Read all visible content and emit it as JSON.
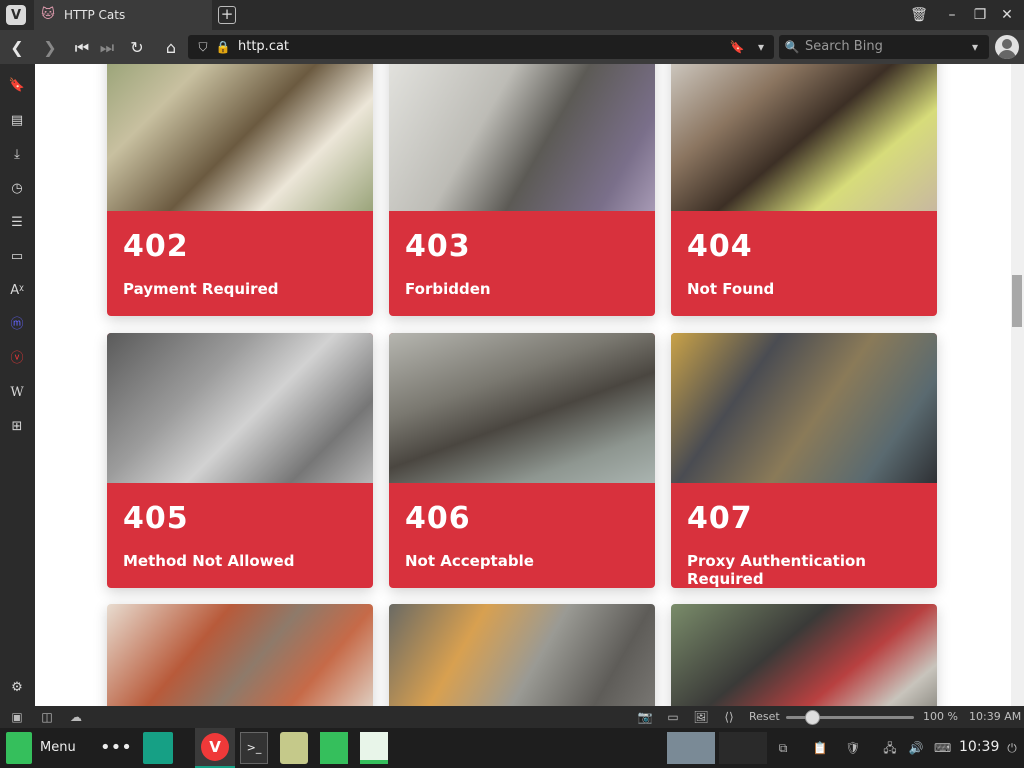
{
  "browser": {
    "tab_title": "HTTP Cats",
    "url": "http.cat",
    "search_placeholder": "Search Bing",
    "brand_color": "#d8313d"
  },
  "cards": [
    {
      "code": "402",
      "message": "Payment Required"
    },
    {
      "code": "403",
      "message": "Forbidden"
    },
    {
      "code": "404",
      "message": "Not Found"
    },
    {
      "code": "405",
      "message": "Method Not Allowed"
    },
    {
      "code": "406",
      "message": "Not Acceptable"
    },
    {
      "code": "407",
      "message": "Proxy Authentication Required"
    }
  ],
  "status_bar": {
    "reset_label": "Reset",
    "zoom": "100 %",
    "time": "10:39 AM"
  },
  "taskbar": {
    "menu_label": "Menu",
    "clock": "10:39"
  },
  "sidebar_icons": [
    "bookmark-icon",
    "reading-list-icon",
    "downloads-icon",
    "history-icon",
    "notes-icon",
    "window-panel-icon",
    "translate-icon",
    "mastodon-icon",
    "vivaldi-icon",
    "wikipedia-icon",
    "add-panel-icon"
  ]
}
